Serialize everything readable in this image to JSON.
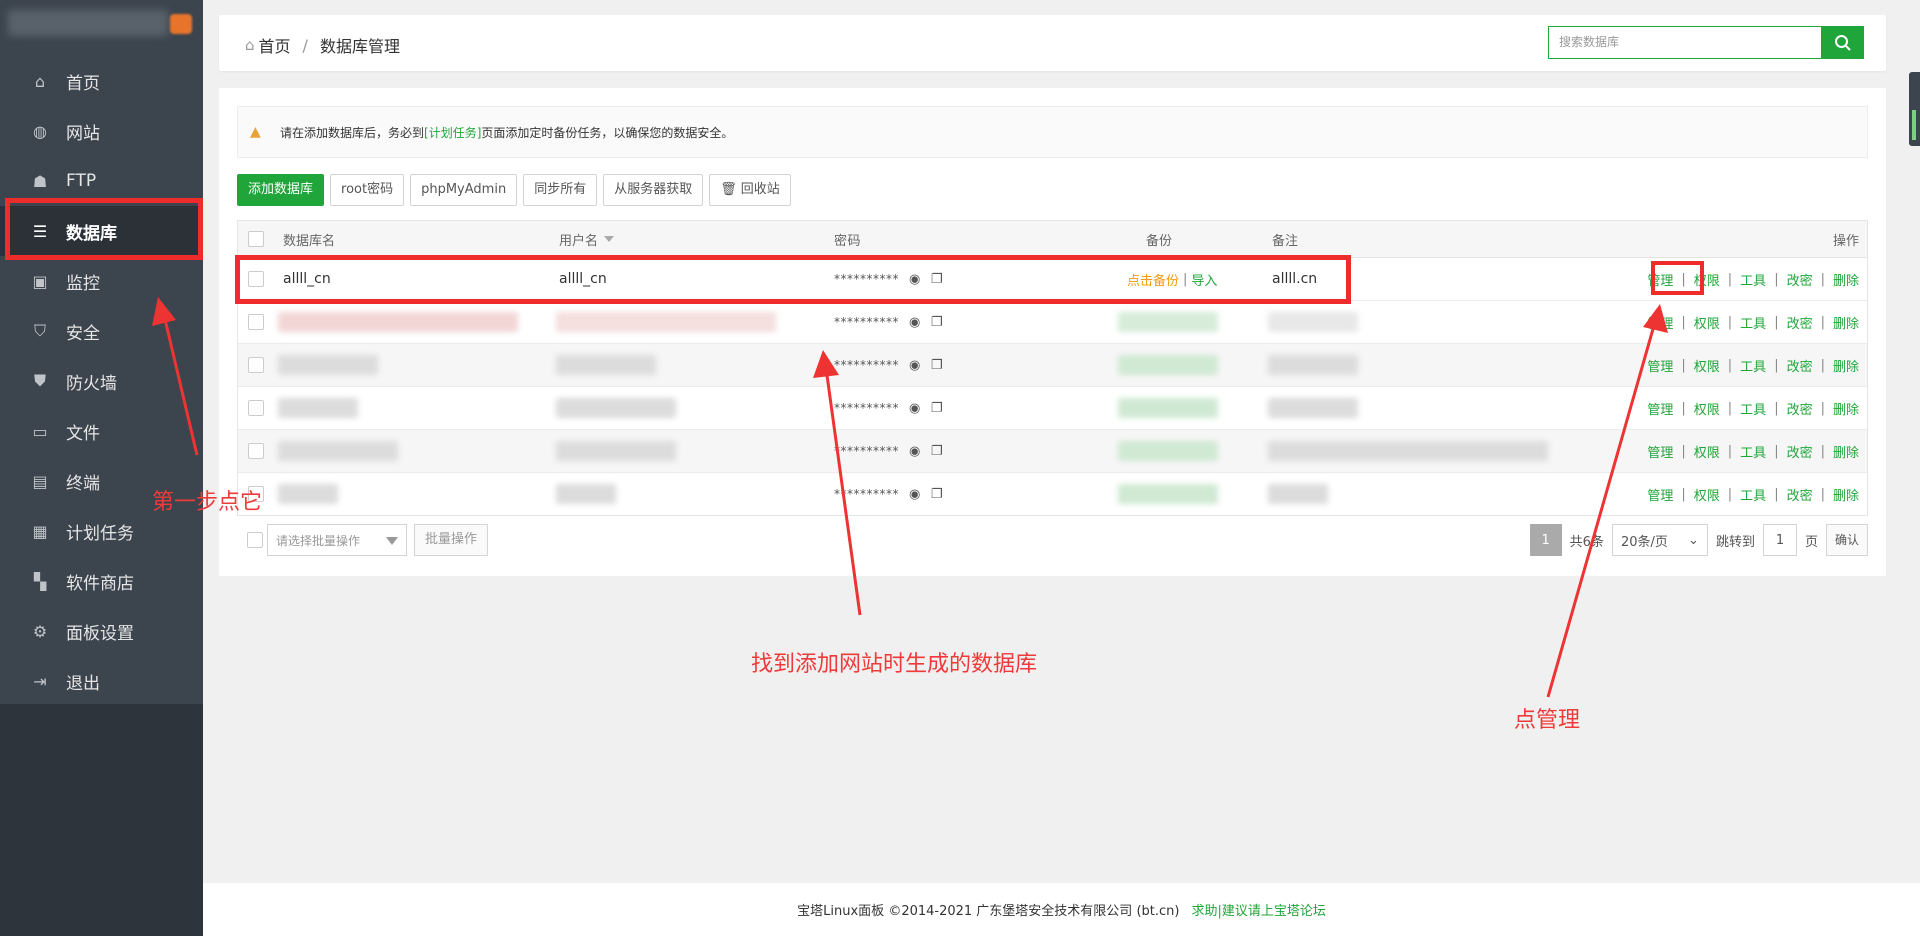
{
  "sidebar": {
    "items": [
      {
        "label": "首页",
        "icon": "home-icon"
      },
      {
        "label": "网站",
        "icon": "globe-icon"
      },
      {
        "label": "FTP",
        "icon": "ftp-icon"
      },
      {
        "label": "数据库",
        "icon": "database-icon",
        "active": true
      },
      {
        "label": "监控",
        "icon": "monitor-icon"
      },
      {
        "label": "安全",
        "icon": "shield-icon"
      },
      {
        "label": "防火墙",
        "icon": "firewall-icon"
      },
      {
        "label": "文件",
        "icon": "folder-icon"
      },
      {
        "label": "终端",
        "icon": "terminal-icon"
      },
      {
        "label": "计划任务",
        "icon": "calendar-icon"
      },
      {
        "label": "软件商店",
        "icon": "apps-icon"
      },
      {
        "label": "面板设置",
        "icon": "gear-icon"
      },
      {
        "label": "退出",
        "icon": "logout-icon"
      }
    ]
  },
  "header": {
    "breadcrumb_home": "首页",
    "breadcrumb_sep": "/",
    "breadcrumb_current": "数据库管理",
    "search_placeholder": "搜索数据库"
  },
  "notice": {
    "text_before": "请在添加数据库后，务必到",
    "link": "[计划任务]",
    "text_after": "页面添加定时备份任务，以确保您的数据安全。"
  },
  "toolbar": {
    "add_db": "添加数据库",
    "root_pwd": "root密码",
    "phpmyadmin": "phpMyAdmin",
    "sync_all": "同步所有",
    "fetch_server": "从服务器获取",
    "recycle": "回收站"
  },
  "table": {
    "columns": {
      "name": "数据库名",
      "user": "用户名",
      "password": "密码",
      "backup": "备份",
      "note": "备注",
      "ops": "操作"
    },
    "row1": {
      "name": "allll_cn",
      "user": "allll_cn",
      "password": "**********",
      "backup_action": "点击备份",
      "backup_sep": "|",
      "import": "导入",
      "note": "allll.cn"
    },
    "masked_password": "**********",
    "ops": {
      "manage": "管理",
      "perm": "权限",
      "tools": "工具",
      "change_pwd": "改密",
      "delete": "删除",
      "sep": "|"
    }
  },
  "bottom": {
    "batch_select_placeholder": "请选择批量操作",
    "batch_btn": "批量操作",
    "page_current": "1",
    "total": "共6条",
    "per_page": "20条/页",
    "jump_label": "跳转到",
    "jump_value": "1",
    "page_unit": "页",
    "confirm": "确认"
  },
  "footer": {
    "copyright": "宝塔Linux面板 ©2014-2021 广东堡塔安全技术有限公司 (bt.cn)",
    "help": "求助|建议请上宝塔论坛"
  },
  "annotations": {
    "step1": "第一步点它",
    "find_db": "找到添加网站时生成的数据库",
    "click_manage": "点管理"
  },
  "colors": {
    "accent": "#20a53a",
    "sidebar_bg": "#3c444d",
    "annotation_red": "#ee2c2c"
  }
}
